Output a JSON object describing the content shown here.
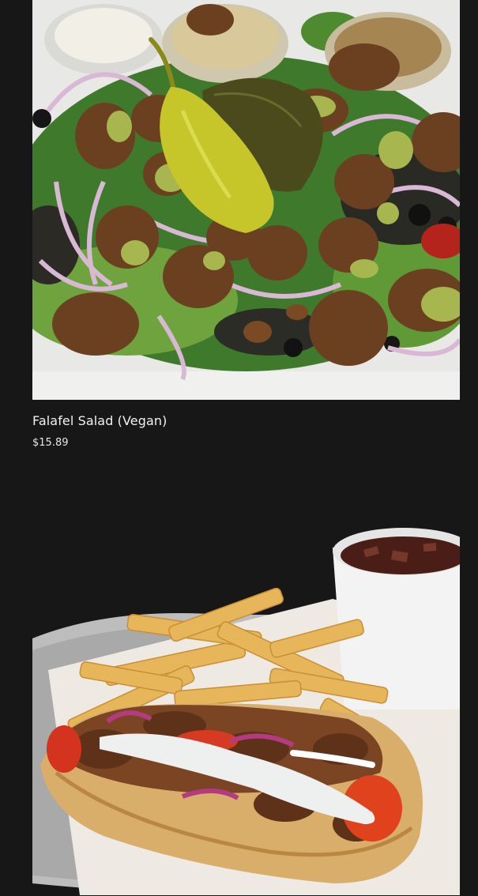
{
  "menu": {
    "items": [
      {
        "name": "Falafel Salad (Vegan)",
        "price": "$15.89",
        "photo_icon": "falafel-salad-photo"
      },
      {
        "photo_icon": "gyro-fries-drink-photo"
      }
    ]
  },
  "colors": {
    "background": "#171717",
    "text": "#f1f1f1"
  }
}
